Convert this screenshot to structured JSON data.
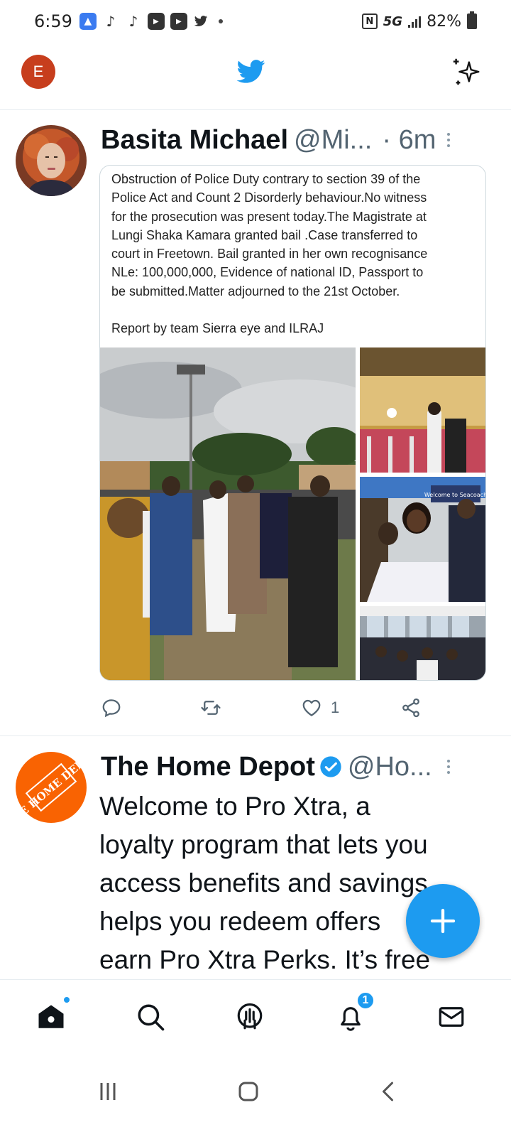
{
  "status_bar": {
    "time": "6:59",
    "network": "5G",
    "battery": "82%",
    "nfc_label": "N",
    "left_icons": [
      "android-auto-icon",
      "tiktok-icon",
      "tiktok-icon",
      "youtube-icon",
      "youtube-icon",
      "twitter-icon"
    ]
  },
  "header": {
    "avatar_letter": "E",
    "logo_icon": "twitter-bird-icon",
    "sparkle_icon": "sparkle-icon"
  },
  "tweets": [
    {
      "name": "Basita Michael",
      "handle": "@Mi...",
      "separator": "·",
      "time": "6m",
      "quoted_text": [
        "Obstruction of Police Duty contrary to section 39 of the",
        "Police Act and Count 2 Disorderly behaviour.No witness",
        "for the prosecution was present today.The Magistrate at",
        "Lungi Shaka Kamara granted bail .Case transferred to",
        "court in Freetown. Bail granted in her own recognisance",
        "NLe: 100,000,000, Evidence of national ID, Passport to",
        "be submitted.Matter adjourned to the 21st October."
      ],
      "quoted_footer": "Report by team Sierra eye and ILRAJ",
      "photo_sign_text": "Welcome to Seacoach",
      "actions": {
        "reply_count": "",
        "retweet_count": "",
        "like_count": "1"
      }
    },
    {
      "name": "The Home Depot",
      "handle": "@Ho...",
      "avatar_text": "THE HOME DEPOT",
      "body_lines": [
        "Welcome to Pro Xtra, a",
        "loyalty program that lets you",
        "access benefits and savings,",
        "helps you redeem offers",
        "earn Pro Xtra Perks. It’s free"
      ]
    }
  ],
  "fab": {
    "icon": "plus-icon"
  },
  "bottom_nav": {
    "items": [
      "home-icon",
      "search-icon",
      "spaces-icon",
      "notifications-icon",
      "messages-icon"
    ],
    "notification_count": "1"
  },
  "colors": {
    "accent": "#1d9bf0",
    "header_avatar": "#c73e1d",
    "home_depot": "#f96302"
  }
}
